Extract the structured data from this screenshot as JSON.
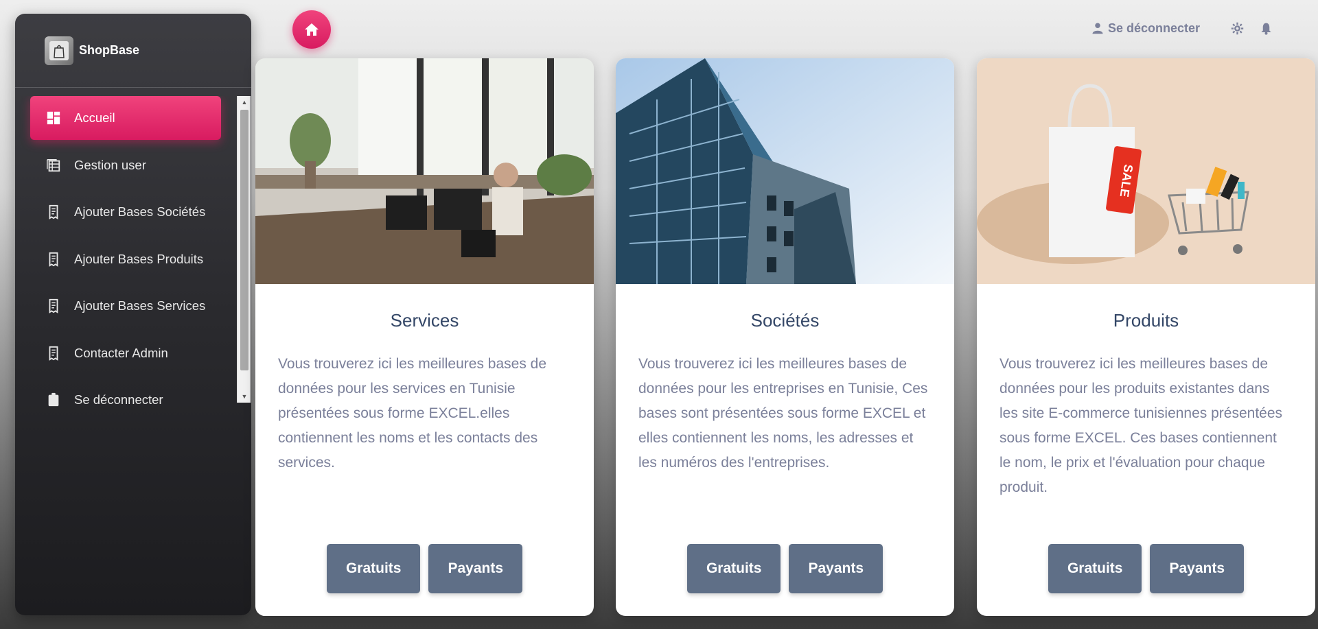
{
  "brand": {
    "name": "ShopBase",
    "logo_text": "ShopBase"
  },
  "sidebar": {
    "items": [
      {
        "label": "Accueil",
        "icon": "dashboard-icon",
        "active": true
      },
      {
        "label": "Gestion user",
        "icon": "table-icon",
        "active": false
      },
      {
        "label": "Ajouter Bases Sociétés",
        "icon": "receipt-icon",
        "active": false
      },
      {
        "label": "Ajouter Bases Produits",
        "icon": "receipt-icon",
        "active": false
      },
      {
        "label": "Ajouter Bases Services",
        "icon": "receipt-icon",
        "active": false
      },
      {
        "label": "Contacter Admin",
        "icon": "receipt-icon",
        "active": false
      },
      {
        "label": "Se déconnecter",
        "icon": "assignment-icon",
        "active": false
      }
    ]
  },
  "topbar": {
    "logout_label": "Se déconnecter",
    "icons": [
      "user-icon",
      "gear-icon",
      "bell-icon"
    ]
  },
  "cards": [
    {
      "title": "Services",
      "description": "Vous trouverez ici les meilleures bases de données pour les services en Tunisie présentées sous forme EXCEL.elles contiennent les noms et les contacts des services.",
      "btn_free": "Gratuits",
      "btn_paid": "Payants"
    },
    {
      "title": "Sociétés",
      "description": "Vous trouverez ici les meilleures bases de données pour les entreprises en Tunisie, Ces bases sont présentées sous forme EXCEL et elles contiennent les noms, les adresses et les numéros des l'entreprises.",
      "btn_free": "Gratuits",
      "btn_paid": "Payants"
    },
    {
      "title": "Produits",
      "description": "Vous trouverez ici les meilleures bases de données pour les produits existantes dans les site E-commerce tunisiennes présentées sous forme EXCEL. Ces bases contiennent le nom, le prix et l'évaluation pour chaque produit.",
      "btn_free": "Gratuits",
      "btn_paid": "Payants"
    }
  ],
  "image_labels": {
    "sale_tag": "SALE"
  },
  "colors": {
    "accent": "#e91e63",
    "button": "#5f6f87",
    "title": "#344767",
    "text_muted": "#7b809a",
    "sidebar_bg": "#2a2a2e"
  }
}
